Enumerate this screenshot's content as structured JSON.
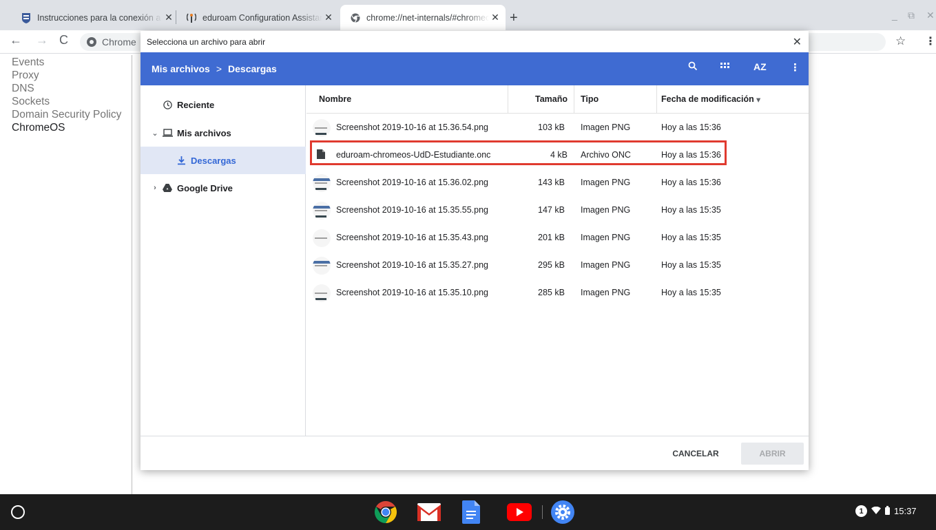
{
  "browser": {
    "tabs": [
      {
        "title": "Instrucciones para la conexión a",
        "icon": "university-icon",
        "active": false
      },
      {
        "title": "eduroam Configuration Assistant",
        "icon": "eduroam-icon",
        "active": false
      },
      {
        "title": "chrome://net-internals/#chromeos",
        "icon": "chrome-page-icon",
        "active": true
      }
    ],
    "omnibox_text": "Chrome"
  },
  "page": {
    "nav_items": [
      "Events",
      "Proxy",
      "DNS",
      "Sockets",
      "Domain Security Policy",
      "ChromeOS"
    ],
    "active_item": "ChromeOS"
  },
  "dialog": {
    "title": "Selecciona un archivo para abrir",
    "breadcrumb": [
      "Mis archivos",
      "Descargas"
    ],
    "breadcrumb_separator": ">",
    "sort_label": "AZ",
    "sidebar": {
      "recent": "Reciente",
      "my_files": "Mis archivos",
      "downloads": "Descargas",
      "google_drive": "Google Drive"
    },
    "columns": {
      "name": "Nombre",
      "size": "Tamaño",
      "type": "Tipo",
      "modified": "Fecha de modificación"
    },
    "sort_indicator": "▾",
    "files": [
      {
        "name": "Screenshot 2019-10-16 at 15.36.54.png",
        "size": "103 kB",
        "type": "Imagen PNG",
        "modified": "Hoy a las 15:36",
        "icon": "image-thumbnail"
      },
      {
        "name": "eduroam-chromeos-UdD-Estudiante.onc",
        "size": "4 kB",
        "type": "Archivo ONC",
        "modified": "Hoy a las 15:36",
        "icon": "file-icon"
      },
      {
        "name": "Screenshot 2019-10-16 at 15.36.02.png",
        "size": "143 kB",
        "type": "Imagen PNG",
        "modified": "Hoy a las 15:36",
        "icon": "image-thumbnail"
      },
      {
        "name": "Screenshot 2019-10-16 at 15.35.55.png",
        "size": "147 kB",
        "type": "Imagen PNG",
        "modified": "Hoy a las 15:35",
        "icon": "image-thumbnail"
      },
      {
        "name": "Screenshot 2019-10-16 at 15.35.43.png",
        "size": "201 kB",
        "type": "Imagen PNG",
        "modified": "Hoy a las 15:35",
        "icon": "image-thumbnail"
      },
      {
        "name": "Screenshot 2019-10-16 at 15.35.27.png",
        "size": "295 kB",
        "type": "Imagen PNG",
        "modified": "Hoy a las 15:35",
        "icon": "image-thumbnail"
      },
      {
        "name": "Screenshot 2019-10-16 at 15.35.10.png",
        "size": "285 kB",
        "type": "Imagen PNG",
        "modified": "Hoy a las 15:35",
        "icon": "image-thumbnail"
      }
    ],
    "buttons": {
      "cancel": "CANCELAR",
      "open": "ABRIR"
    }
  },
  "shelf": {
    "apps": [
      "chrome-icon",
      "gmail-icon",
      "docs-icon",
      "youtube-icon",
      "settings-icon"
    ],
    "notification_count": "1",
    "time": "15:37"
  },
  "colors": {
    "dialog_header": "#3f6bd2",
    "selected_nav": "#e1e7f5",
    "highlight_box": "#e03a2f",
    "shelf": "#1c1c1c"
  }
}
